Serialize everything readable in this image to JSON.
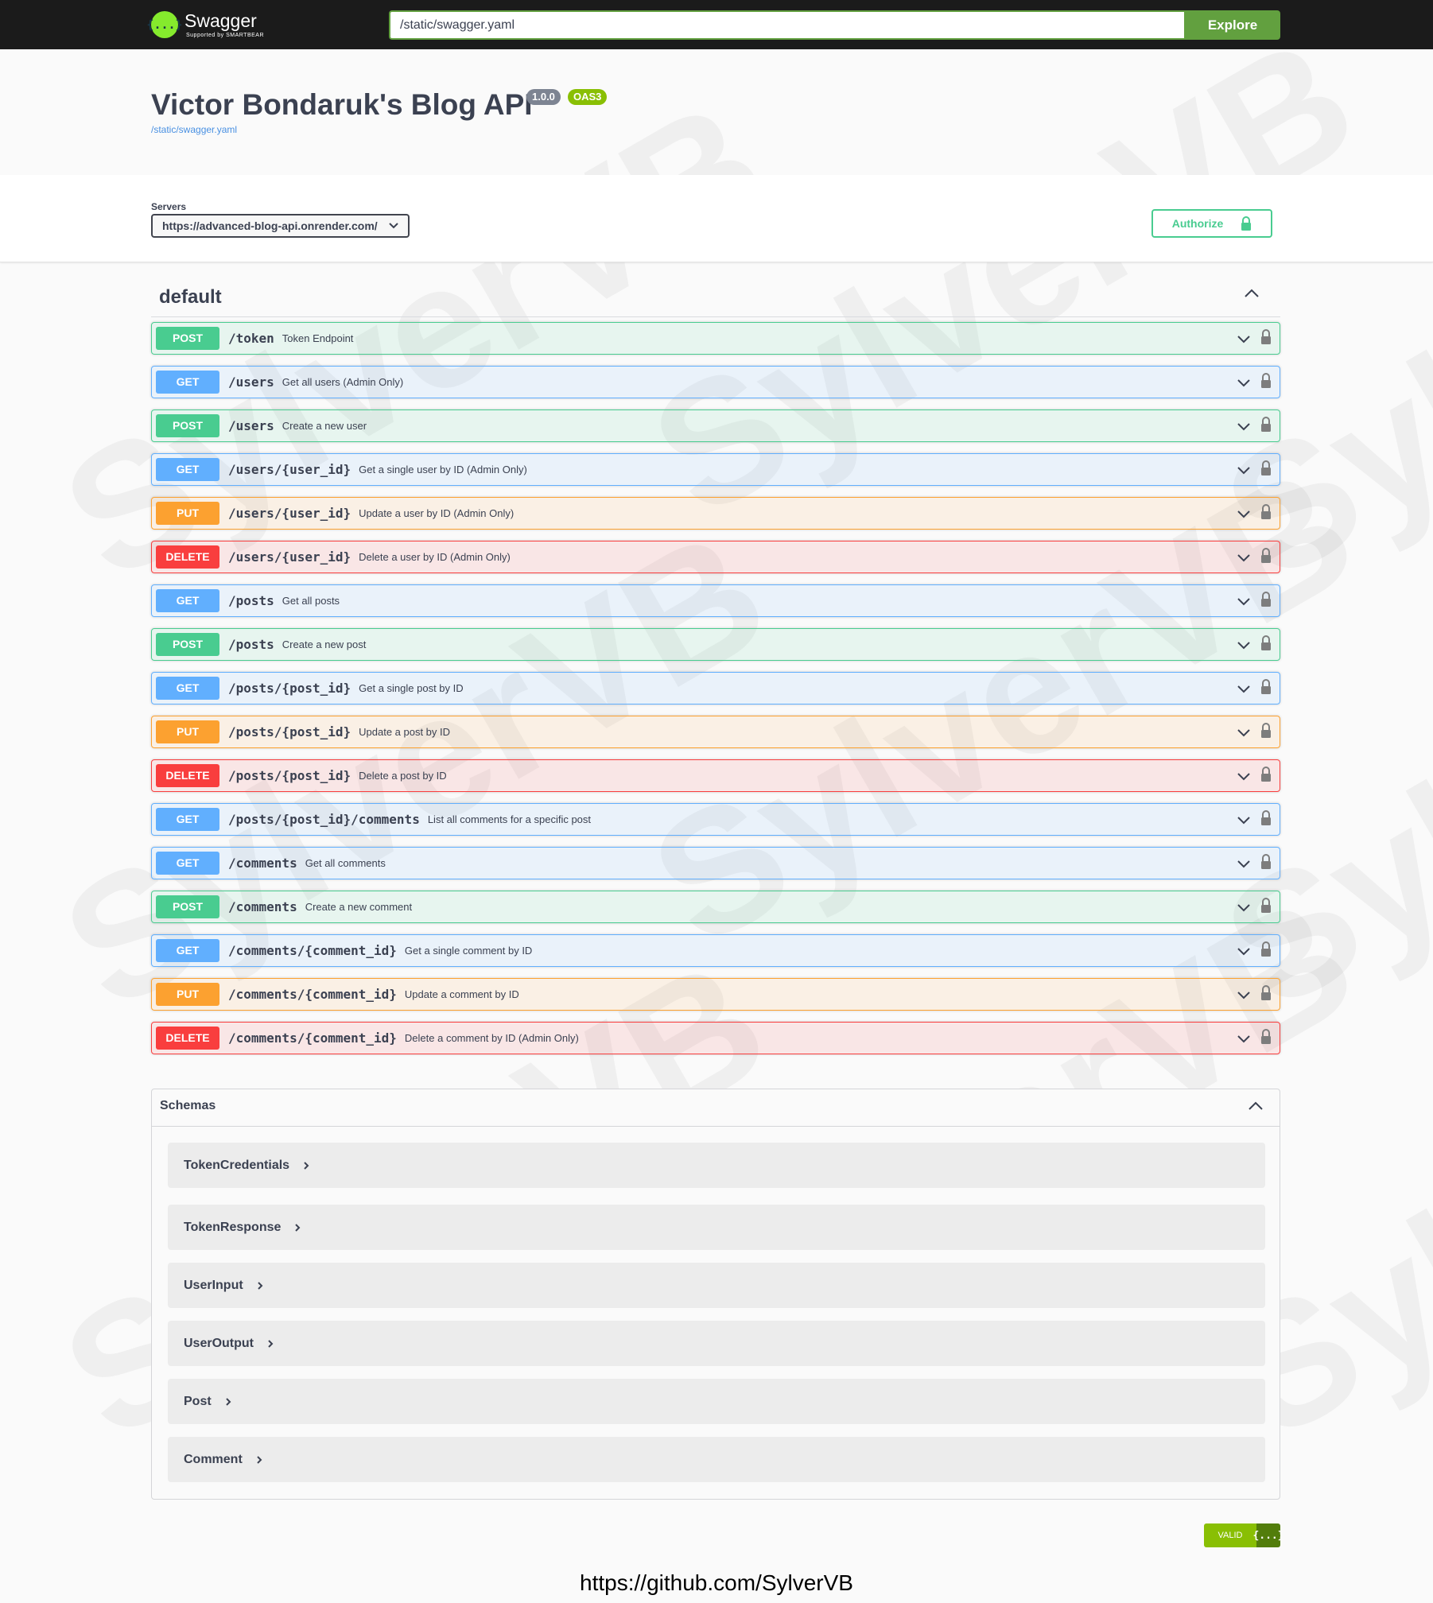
{
  "topbar": {
    "logo_title": "Swagger",
    "logo_subtitle": "Supported by SMARTBEAR",
    "url_value": "/static/swagger.yaml",
    "explore_label": "Explore"
  },
  "info": {
    "title": "Victor Bondaruk's Blog API",
    "version": "1.0.0",
    "oas": "OAS3",
    "spec_link": "/static/swagger.yaml"
  },
  "servers": {
    "label": "Servers",
    "selected": "https://advanced-blog-api.onrender.com/"
  },
  "authorize_label": "Authorize",
  "tag": {
    "name": "default"
  },
  "operations": [
    {
      "method": "POST",
      "path": "/token",
      "summary": "Token Endpoint"
    },
    {
      "method": "GET",
      "path": "/users",
      "summary": "Get all users (Admin Only)"
    },
    {
      "method": "POST",
      "path": "/users",
      "summary": "Create a new user"
    },
    {
      "method": "GET",
      "path": "/users/{user_id}",
      "summary": "Get a single user by ID (Admin Only)"
    },
    {
      "method": "PUT",
      "path": "/users/{user_id}",
      "summary": "Update a user by ID (Admin Only)"
    },
    {
      "method": "DELETE",
      "path": "/users/{user_id}",
      "summary": "Delete a user by ID (Admin Only)"
    },
    {
      "method": "GET",
      "path": "/posts",
      "summary": "Get all posts"
    },
    {
      "method": "POST",
      "path": "/posts",
      "summary": "Create a new post"
    },
    {
      "method": "GET",
      "path": "/posts/{post_id}",
      "summary": "Get a single post by ID"
    },
    {
      "method": "PUT",
      "path": "/posts/{post_id}",
      "summary": "Update a post by ID"
    },
    {
      "method": "DELETE",
      "path": "/posts/{post_id}",
      "summary": "Delete a post by ID"
    },
    {
      "method": "GET",
      "path": "/posts/{post_id}/comments",
      "summary": "List all comments for a specific post"
    },
    {
      "method": "GET",
      "path": "/comments",
      "summary": "Get all comments"
    },
    {
      "method": "POST",
      "path": "/comments",
      "summary": "Create a new comment"
    },
    {
      "method": "GET",
      "path": "/comments/{comment_id}",
      "summary": "Get a single comment by ID"
    },
    {
      "method": "PUT",
      "path": "/comments/{comment_id}",
      "summary": "Update a comment by ID"
    },
    {
      "method": "DELETE",
      "path": "/comments/{comment_id}",
      "summary": "Delete a comment by ID (Admin Only)"
    }
  ],
  "schemas": {
    "title": "Schemas",
    "models": [
      "TokenCredentials",
      "TokenResponse",
      "UserInput",
      "UserOutput",
      "Post",
      "Comment"
    ]
  },
  "validator": {
    "label": "VALID",
    "icon": "{...}"
  },
  "watermark": "SylverVB",
  "footer_url": "https://github.com/SylverVB",
  "icons": {
    "logo": "swagger-logo-icon",
    "chevron_down": "chevron-down-icon",
    "chevron_up": "chevron-up-icon",
    "chevron_right": "chevron-right-icon",
    "lock": "lock-icon"
  },
  "colors": {
    "get": "#61affe",
    "post": "#49cc90",
    "put": "#fca130",
    "delete": "#f93e3e",
    "topbar": "#1b1b1b",
    "explore": "#62a03f",
    "oas_badge": "#89bf04"
  }
}
